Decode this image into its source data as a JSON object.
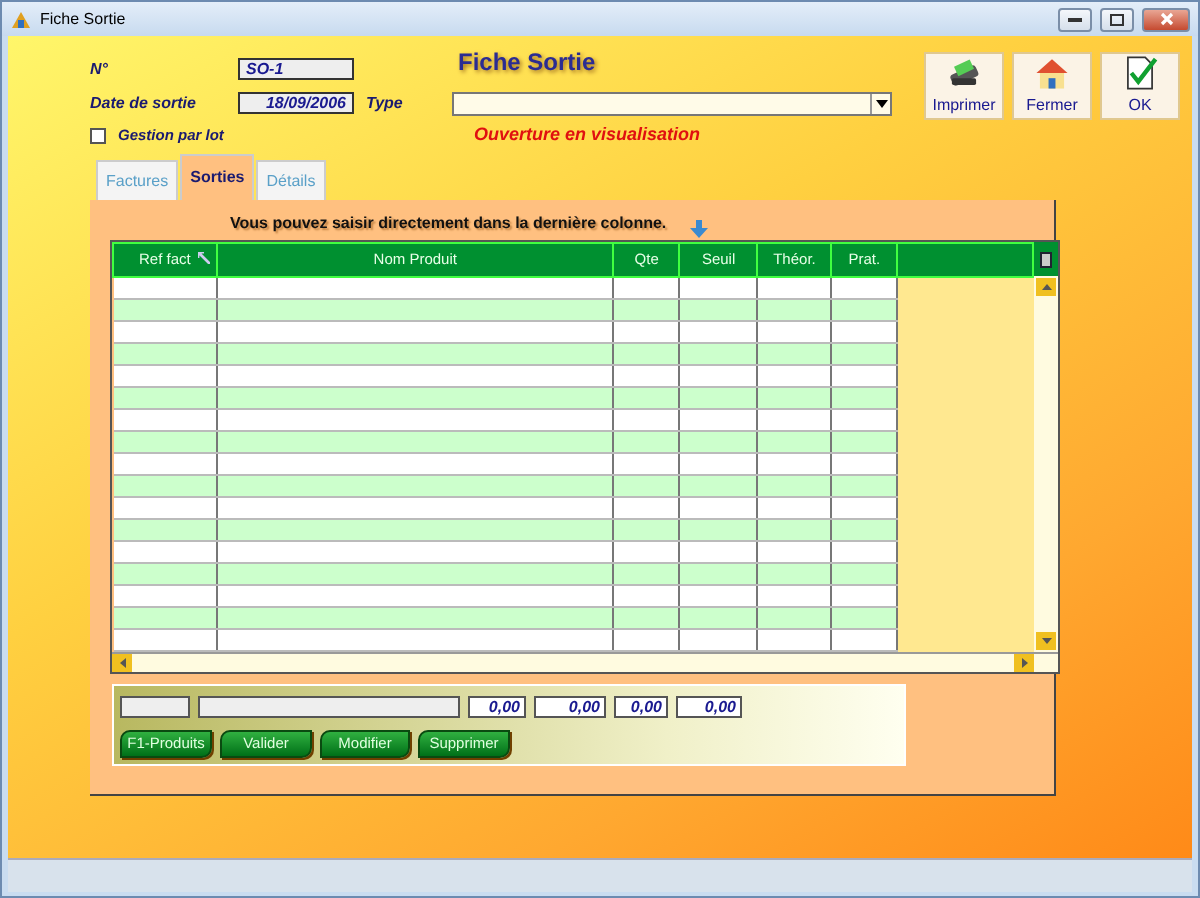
{
  "window": {
    "title": "Fiche Sortie"
  },
  "form": {
    "heading": "Fiche Sortie",
    "fields": [
      {
        "label": "N°",
        "value": "SO-1"
      },
      {
        "label": "Date de sortie",
        "value": "18/09/2006"
      }
    ],
    "type": {
      "label": "Type"
    },
    "lot": {
      "label": "Gestion par lot",
      "checked": false
    },
    "status_message": "Ouverture en visualisation"
  },
  "actions": [
    {
      "label": "Imprimer",
      "kind": "print"
    },
    {
      "label": "Fermer",
      "kind": "home"
    },
    {
      "label": "OK",
      "kind": "ok"
    }
  ],
  "tabs": [
    {
      "label": "Factures",
      "selected": false
    },
    {
      "label": "Sorties",
      "selected": true
    },
    {
      "label": "Détails",
      "selected": false
    }
  ],
  "hint": "Vous pouvez saisir directement dans la dernière colonne.",
  "table": {
    "columns": [
      {
        "label": "Ref fact",
        "sort_icon": true
      },
      {
        "label": "Nom Produit",
        "sort_icon": false
      },
      {
        "label": "Qte",
        "sort_icon": false
      },
      {
        "label": "Seuil",
        "sort_icon": false
      },
      {
        "label": "Théor.",
        "sort_icon": false
      },
      {
        "label": "Prat.",
        "sort_icon": false
      }
    ]
  },
  "totals": [
    "0,00",
    "0,00",
    "0,00",
    "0,00"
  ],
  "buttons": [
    "F1-Produits",
    "Valider",
    "Modifier",
    "Supprimer"
  ]
}
